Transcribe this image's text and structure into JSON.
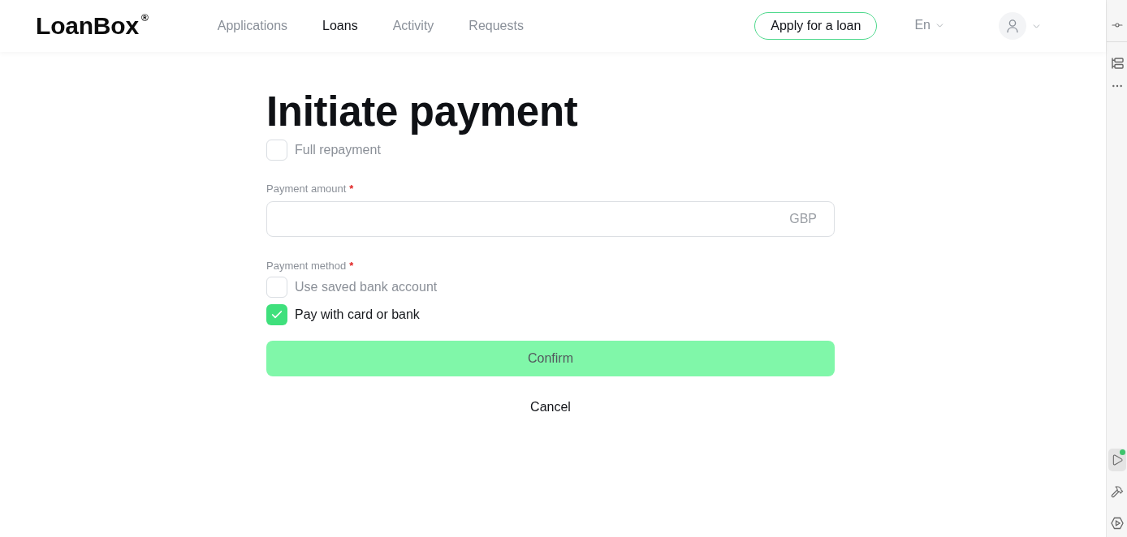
{
  "header": {
    "logo": "LoanBox",
    "logo_mark": "®",
    "nav": [
      {
        "label": "Applications",
        "selected": false
      },
      {
        "label": "Loans",
        "selected": true
      },
      {
        "label": "Activity",
        "selected": false
      },
      {
        "label": "Requests",
        "selected": false
      }
    ],
    "apply_button": "Apply for a loan",
    "language": "En"
  },
  "form": {
    "title": "Initiate payment",
    "full_repayment": {
      "label": "Full repayment",
      "checked": false
    },
    "amount": {
      "label": "Payment amount",
      "required_mark": "*",
      "currency": "GBP"
    },
    "method": {
      "label": "Payment method",
      "required_mark": "*",
      "options": [
        {
          "label": "Use saved bank account",
          "checked": false
        },
        {
          "label": "Pay with card or bank",
          "checked": true
        }
      ]
    },
    "confirm_button": "Confirm",
    "cancel_button": "Cancel"
  },
  "side_toolbar": {
    "top_tools": [
      {
        "kind": "commit",
        "selected": false,
        "badge": false
      },
      {
        "kind": "structure",
        "selected": false,
        "badge": false
      },
      {
        "kind": "more",
        "selected": false,
        "badge": false
      }
    ],
    "bottom_tools": [
      {
        "kind": "run",
        "selected": true,
        "badge": true
      },
      {
        "kind": "build",
        "selected": false,
        "badge": false
      },
      {
        "kind": "preview",
        "selected": false,
        "badge": false
      }
    ]
  }
}
